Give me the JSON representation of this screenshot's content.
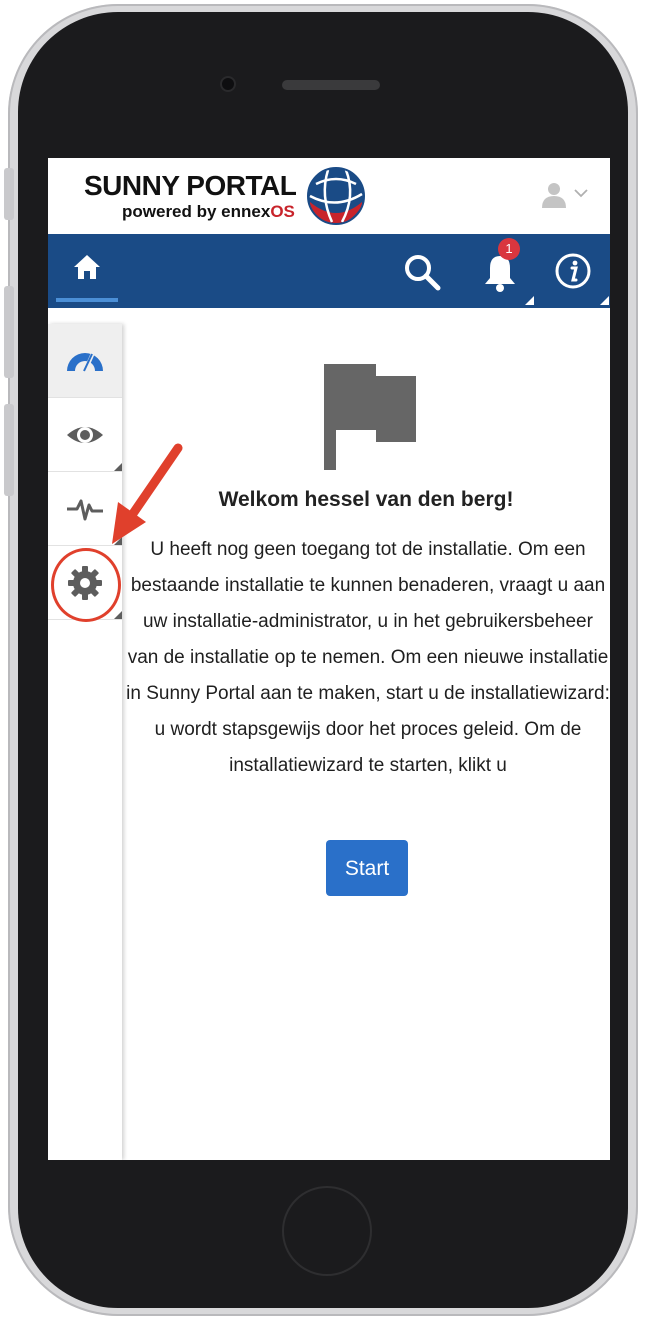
{
  "header": {
    "logo_title": "SUNNY PORTAL",
    "logo_powered": "powered by ennex",
    "logo_os": "OS"
  },
  "navbar": {
    "notification_count": "1",
    "icons": [
      "home-icon",
      "search-icon",
      "bell-icon",
      "info-icon"
    ]
  },
  "sidebar": {
    "items": [
      {
        "name": "dashboard",
        "icon": "gauge-icon"
      },
      {
        "name": "monitoring",
        "icon": "eye-icon"
      },
      {
        "name": "analysis",
        "icon": "pulse-icon"
      },
      {
        "name": "configuration",
        "icon": "gear-icon"
      }
    ]
  },
  "main": {
    "welcome": "Welkom hessel van den berg!",
    "message": "U heeft nog geen toegang tot de installatie. Om een bestaande installatie te kunnen benaderen, vraagt u aan uw installatie-administrator, u in het gebruikersbeheer van de installatie op te nemen. Om een nieuwe installatie in Sunny Portal aan te maken, start u de installatiewizard: u wordt stapsgewijs door het proces geleid. Om de installatiewizard te starten, klikt u",
    "start_label": "Start"
  },
  "colors": {
    "navbar": "#1a4b86",
    "accent": "#2a70c9",
    "badge": "#d9363e",
    "annotation": "#e0402c"
  }
}
